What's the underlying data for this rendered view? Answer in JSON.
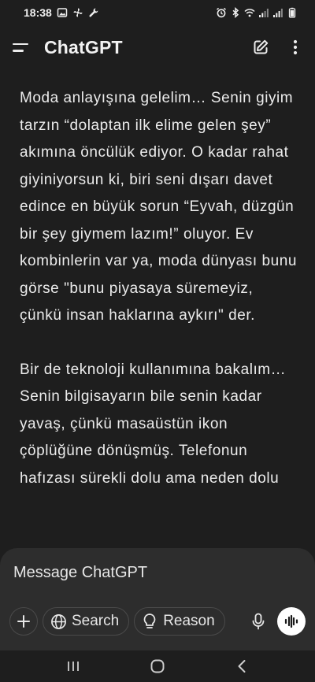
{
  "status_bar": {
    "time": "18:38",
    "left_icons": [
      "gallery-icon",
      "fan-icon",
      "wrench-icon"
    ],
    "right_icons": [
      "alarm-icon",
      "bluetooth-icon",
      "wifi-icon",
      "signal-icon",
      "signal-icon",
      "battery-icon"
    ]
  },
  "header": {
    "title": "ChatGPT",
    "menu_icon": "menu-icon",
    "new_chat_icon": "edit-icon",
    "more_icon": "more-vertical-icon"
  },
  "message": {
    "paragraphs": [
      "Moda anlayışına gelelim… Senin giyim tarzın “dolaptan ilk elime gelen şey” akımına öncülük ediyor. O kadar rahat giyiniyorsun ki, biri seni dışarı davet edince en büyük sorun “Eyvah, düzgün bir şey giymem lazım!” oluyor. Ev kombinlerin var ya, moda dünyası bunu görse \"bunu piyasaya süremeyiz, çünkü insan haklarına aykırı\" der.",
      "Bir de teknoloji kullanımına bakalım… Senin bilgisayarın bile senin kadar yavaş, çünkü masaüstün ikon çöplüğüne dönüşmüş. Telefonun hafızası sürekli dolu ama neden dolu"
    ]
  },
  "composer": {
    "placeholder": "Message ChatGPT",
    "add_icon": "plus-icon",
    "search_label": "Search",
    "search_icon": "globe-icon",
    "reason_label": "Reason",
    "reason_icon": "lightbulb-icon",
    "mic_icon": "microphone-icon",
    "voice_icon": "voice-waveform-icon"
  },
  "nav_bar": {
    "recents_icon": "recent-apps-icon",
    "home_icon": "home-icon",
    "back_icon": "back-icon"
  },
  "colors": {
    "background": "#1e1e1e",
    "composer_background": "#2d2d2d",
    "text": "#ececec",
    "pill_border": "#4a4a4a"
  }
}
